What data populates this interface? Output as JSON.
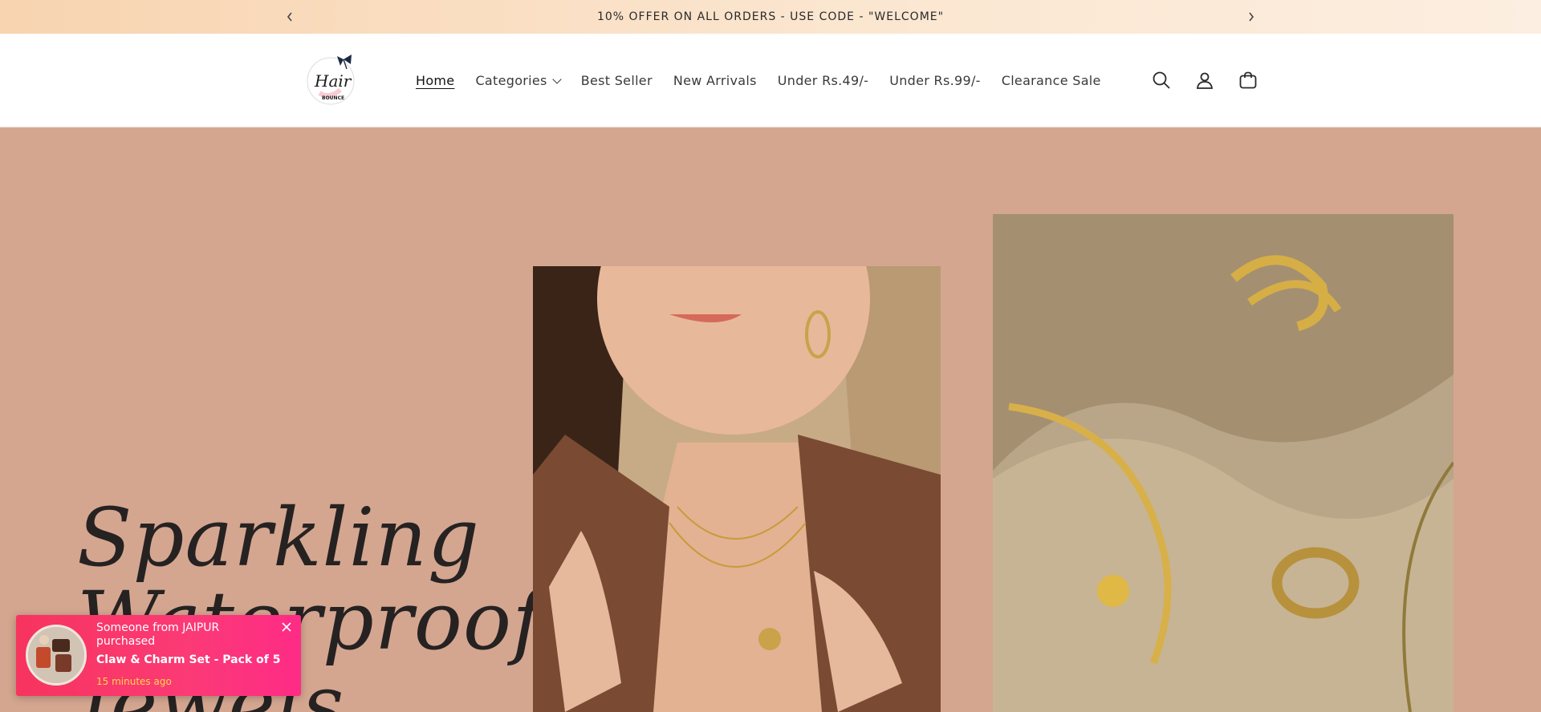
{
  "announcement": {
    "text": "10% OFFER ON ALL ORDERS - USE CODE - \"WELCOME\"",
    "prev_icon": "chevron-left-icon",
    "next_icon": "chevron-right-icon"
  },
  "header": {
    "logo_word": "Hair",
    "logo_sub": "BOUNCE",
    "nav": [
      {
        "label": "Home",
        "active": true
      },
      {
        "label": "Categories",
        "dropdown": true
      },
      {
        "label": "Best Seller"
      },
      {
        "label": "New Arrivals"
      },
      {
        "label": "Under Rs.49/-"
      },
      {
        "label": "Under Rs.99/-"
      },
      {
        "label": "Clearance Sale"
      }
    ],
    "icons": [
      "search-icon",
      "account-icon",
      "cart-icon"
    ]
  },
  "hero": {
    "title_line1": "Sparkling",
    "title_line2": "Waterproof",
    "title_line3": "Jewels",
    "background": "#d4a690"
  },
  "toast": {
    "line1": "Someone from JAIPUR purchased",
    "product": "Claw & Charm Set - Pack of 5",
    "time": "15 minutes ago",
    "close_icon": "close-icon"
  }
}
